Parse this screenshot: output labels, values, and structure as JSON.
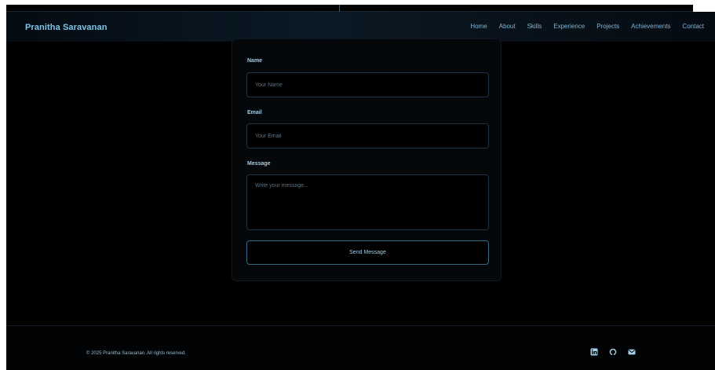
{
  "header": {
    "brand": "Pranitha Saravanan",
    "nav": [
      "Home",
      "About",
      "Skills",
      "Experience",
      "Projects",
      "Achievements",
      "Contact"
    ]
  },
  "contact_form": {
    "name_label": "Name",
    "name_placeholder": "Your Name",
    "email_label": "Email",
    "email_placeholder": "Your Email",
    "message_label": "Message",
    "message_placeholder": "Write your message...",
    "submit_label": "Send Message"
  },
  "footer": {
    "copyright": "© 2025 Pranitha Saravanan. All rights reserved.",
    "social_icons": [
      "linkedin-icon",
      "github-icon",
      "email-icon"
    ]
  },
  "colors": {
    "background": "#000000",
    "accent": "#7dc4e8",
    "field_border": "#1e3345"
  }
}
